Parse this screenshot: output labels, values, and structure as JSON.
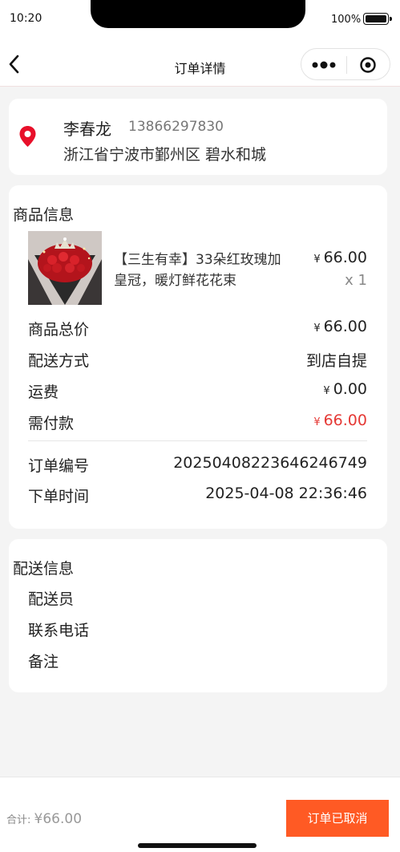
{
  "status_bar": {
    "time": "10:20",
    "battery_text": "100%"
  },
  "nav": {
    "title": "订单详情",
    "icons": [
      "back-chevron-icon",
      "more-dots-icon",
      "close-circle-icon"
    ]
  },
  "address": {
    "name": "李春龙",
    "phone": "13866297830",
    "line": "浙江省宁波市鄞州区 碧水和城",
    "icon": "location-pin-icon",
    "icon_color": "#e8102a"
  },
  "goods": {
    "section_title": "商品信息",
    "item": {
      "name": "【三生有幸】33朵红玫瑰加皇冠，暖灯鲜花花束",
      "price_symbol": "¥",
      "price": "66.00",
      "qty": "x 1"
    },
    "summary": [
      {
        "label": "商品总价",
        "symbol": "¥",
        "value": "66.00"
      },
      {
        "label": "配送方式",
        "symbol": "",
        "value": "到店自提"
      },
      {
        "label": "运费",
        "symbol": "¥",
        "value": "0.00"
      },
      {
        "label": "需付款",
        "symbol": "¥",
        "value": "66.00"
      }
    ],
    "order_no_label": "订单编号",
    "order_no": "20250408223646246749",
    "order_time_label": "下单时间",
    "order_time": "2025-04-08 22:36:46"
  },
  "delivery": {
    "section_title": "配送信息",
    "rows": [
      "配送员",
      "联系电话",
      "备注"
    ]
  },
  "footer": {
    "total_label": "合计:",
    "total_amount": "¥66.00",
    "button_label": "订单已取消",
    "button_color": "#ff5a24"
  },
  "colors": {
    "price_red": "#e53935",
    "accent": "#ff5a24"
  }
}
